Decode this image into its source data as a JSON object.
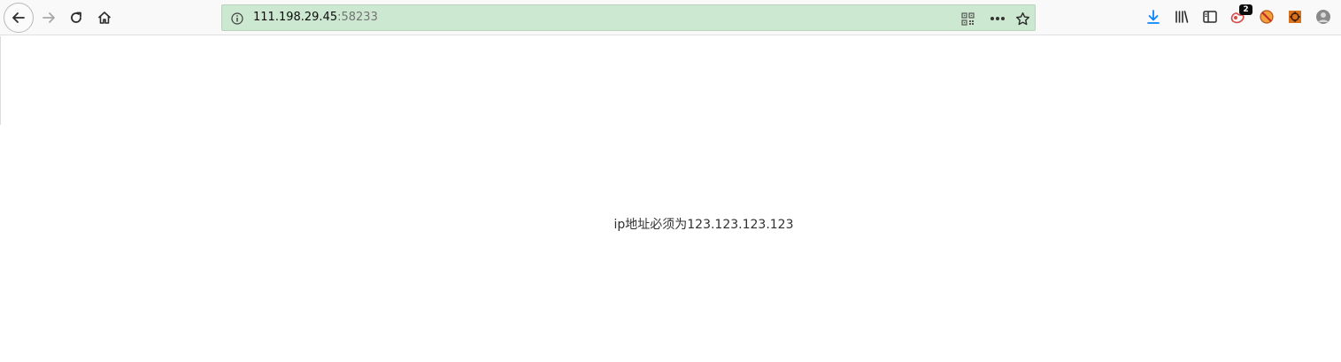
{
  "browser": {
    "nav": {
      "back_icon": "arrow-left-icon",
      "forward_icon": "arrow-right-icon",
      "reload_icon": "reload-icon",
      "home_icon": "home-icon"
    },
    "url_bar": {
      "host": "111.198.29.45",
      "port": ":58233",
      "background": "#cde8d0",
      "icons": [
        "info-icon",
        "qr-code-icon",
        "more-actions-icon",
        "bookmark-star-icon"
      ]
    },
    "toolbar_right": {
      "icons": [
        "download-icon",
        "library-icon",
        "sidebar-icon",
        "extension-icon",
        "extension-round-icon",
        "extension-square-icon",
        "profile-avatar-icon"
      ],
      "download_color": "#0a84ff",
      "extension_badge": "2"
    }
  },
  "page": {
    "message": "ip地址必须为123.123.123.123"
  }
}
